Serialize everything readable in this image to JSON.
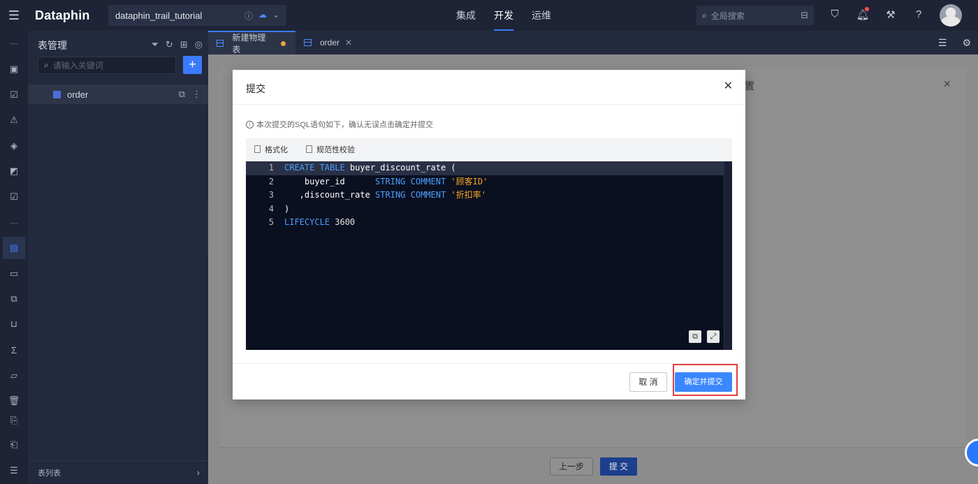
{
  "app": {
    "logo": "Dataphin",
    "project": "dataphin_trail_tutorial"
  },
  "nav": {
    "tabs": [
      "集成",
      "开发",
      "运维"
    ],
    "active": "开发"
  },
  "global_search": {
    "placeholder": "全局搜索"
  },
  "panel": {
    "title": "表管理",
    "search_placeholder": "请输入关键词",
    "add_label": "+",
    "tree": [
      {
        "label": "order"
      }
    ],
    "footer_label": "表列表"
  },
  "editor_tabs": [
    {
      "label": "新建物理表",
      "modified": true,
      "active": true
    },
    {
      "label": "order",
      "modified": false,
      "active": false
    }
  ],
  "background": {
    "title_fragment": "置",
    "prev_label": "上一步",
    "submit_label": "提 交"
  },
  "modal": {
    "title": "提交",
    "info": "本次提交的SQL语句如下，确认无误点击确定并提交",
    "toolbar": {
      "format_label": "格式化",
      "check_label": "规范性校验"
    },
    "code_lines": [
      {
        "n": "1",
        "text": "CREATE TABLE buyer_discount_rate ("
      },
      {
        "n": "2",
        "text": "    buyer_id      STRING COMMENT '顾客ID'"
      },
      {
        "n": "3",
        "text": "   ,discount_rate STRING COMMENT '折扣率'"
      },
      {
        "n": "4",
        "text": ")"
      },
      {
        "n": "5",
        "text": "LIFECYCLE 3600"
      }
    ],
    "cancel_label": "取 消",
    "confirm_label": "确定并提交"
  },
  "colors": {
    "accent": "#3b7bff",
    "highlight": "#e04040",
    "code_bg": "#0b1020",
    "keyword": "#4a9fff",
    "string": "#f5a623"
  }
}
